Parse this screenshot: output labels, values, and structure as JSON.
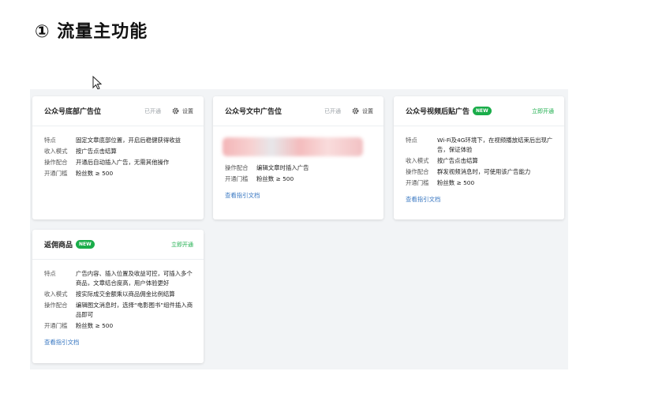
{
  "page_title": "① 流量主功能",
  "cards": [
    {
      "title": "公众号底部广告位",
      "status": "已开通",
      "settings_label": "设置",
      "rows": [
        {
          "label": "特点",
          "value": "固定文章底部位置，开启后稳健获得收益"
        },
        {
          "label": "收入模式",
          "value": "按广告点击结算"
        },
        {
          "label": "操作配合",
          "value": "开通后自动插入广告，无需其他操作"
        },
        {
          "label": "开通门槛",
          "value": "粉丝数 ≥ 500"
        }
      ]
    },
    {
      "title": "公众号文中广告位",
      "status": "已开通",
      "settings_label": "设置",
      "rows": [
        {
          "label": "操作配合",
          "value": "编辑文章时插入广告"
        },
        {
          "label": "开通门槛",
          "value": "粉丝数 ≥ 500"
        }
      ],
      "doc_link": "查看指引文档"
    },
    {
      "title": "公众号视频后贴广告",
      "badge": "NEW",
      "open_label": "立即开通",
      "rows": [
        {
          "label": "特点",
          "value": "Wi-Fi及4G环境下，在视频播放结束后出现广告，保证体验"
        },
        {
          "label": "收入模式",
          "value": "按广告点击结算"
        },
        {
          "label": "操作配合",
          "value": "群发视频消息时，可使用该广告能力"
        },
        {
          "label": "开通门槛",
          "value": "粉丝数 ≥ 500"
        }
      ],
      "doc_link": "查看指引文档"
    },
    {
      "title": "返佣商品",
      "badge": "NEW",
      "open_label": "立即开通",
      "rows": [
        {
          "label": "特点",
          "value": "广告内容、插入位置及收益可控，可插入多个商品，文章结合度高，用户体验更好"
        },
        {
          "label": "收入模式",
          "value": "按实际成交金额乘以商品佣金比例结算"
        },
        {
          "label": "操作配合",
          "value": "编辑图文消息时，选择“电影图书”组件插入商品即可"
        },
        {
          "label": "开通门槛",
          "value": "粉丝数 ≥ 500"
        }
      ],
      "doc_link": "查看指引文档"
    }
  ]
}
